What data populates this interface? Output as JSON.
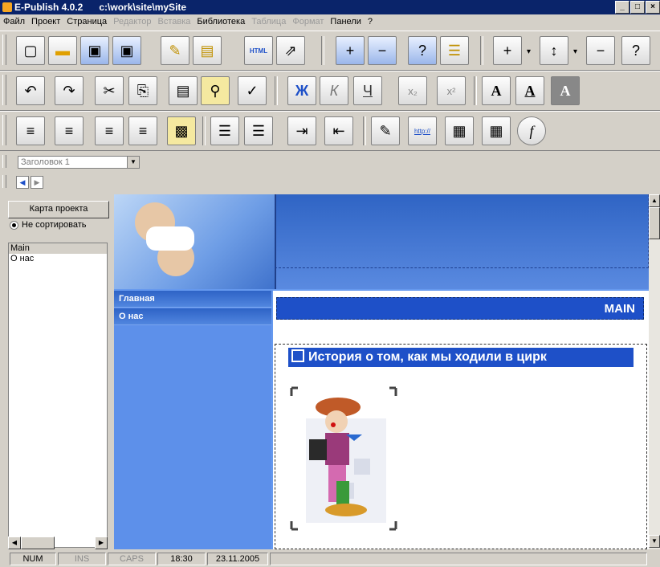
{
  "window": {
    "app_title": "E-Publish 4.0.2",
    "path": "c:\\work\\site\\mySite",
    "buttons": [
      "_",
      "□",
      "×"
    ]
  },
  "menu": [
    {
      "label": "Файл",
      "enabled": true
    },
    {
      "label": "Проект",
      "enabled": true
    },
    {
      "label": "Страница",
      "enabled": true
    },
    {
      "label": "Редактор",
      "enabled": false
    },
    {
      "label": "Вставка",
      "enabled": false
    },
    {
      "label": "Библиотека",
      "enabled": true
    },
    {
      "label": "Таблица",
      "enabled": false
    },
    {
      "label": "Формат",
      "enabled": false
    },
    {
      "label": "Панели",
      "enabled": true
    },
    {
      "label": "?",
      "enabled": true
    }
  ],
  "toolbar": {
    "row1_icons": [
      "new-page-icon",
      "open-folder-icon",
      "save-icon",
      "save-as-icon",
      "wizard-icon",
      "properties-icon",
      "html-export-icon",
      "publish-icon",
      "add-page-icon",
      "remove-page-icon",
      "help-icon",
      "page-list-icon",
      "insert-row-icon",
      "move-row-icon",
      "delete-row-icon",
      "help-row-icon"
    ],
    "html_label": "HTML",
    "row2_icons": [
      "undo-icon",
      "redo-icon",
      "cut-icon",
      "copy-icon",
      "paste-icon",
      "find-icon",
      "clear-format-icon",
      "bold-icon",
      "italic-icon",
      "underline-icon",
      "subscript-icon",
      "superscript-icon",
      "font-icon",
      "font-color-icon",
      "font-background-icon"
    ],
    "bold_label": "Ж",
    "italic_label": "К",
    "underline_label": "Ч",
    "sub_label": "x₂",
    "sup_label": "x²",
    "font_label": "A",
    "row3_icons": [
      "align-left-icon",
      "align-center-icon",
      "align-right-icon",
      "align-justify-icon",
      "image-align-icon",
      "bullet-list-icon",
      "numbered-list-icon",
      "indent-icon",
      "outdent-icon",
      "edit-link-icon",
      "hyperlink-icon",
      "insert-image-icon",
      "insert-table-icon",
      "function-icon"
    ],
    "http_label": "http://",
    "func_label": "f"
  },
  "style_select": {
    "value": "Заголовок 1"
  },
  "left_panel": {
    "map_button": "Карта проекта",
    "sort_option": "Не сортировать",
    "pages": [
      "Main",
      "О нас"
    ],
    "selected_page": "Main"
  },
  "preview": {
    "nav_items": [
      "Главная",
      "О нас"
    ],
    "page_heading": "MAIN",
    "article_title": "История о том, как мы ходили в цирк"
  },
  "status": {
    "num": "NUM",
    "ins": "INS",
    "caps": "CAPS",
    "time": "18:30",
    "date": "23.11.2005"
  },
  "colors": {
    "titlebar": "#0a246a",
    "site_blue": "#1e50c8",
    "nav_blue": "#5d90ea"
  }
}
